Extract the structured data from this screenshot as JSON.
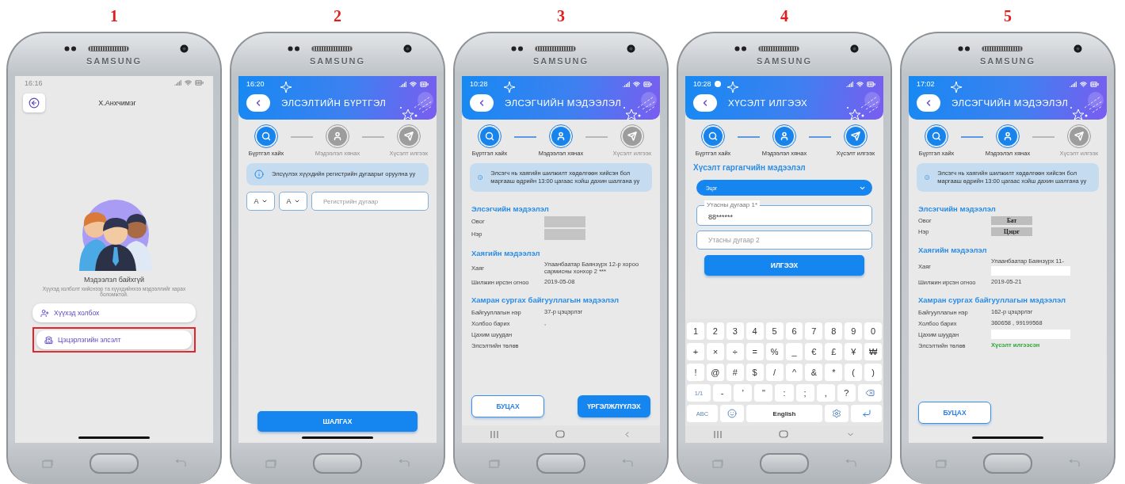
{
  "phones": [
    {
      "number": "1",
      "brand": "SAMSUNG",
      "screen": {
        "kind": "home",
        "time": "16:16",
        "user_name": "Х.Анхчимэг",
        "empty_title": "Мэдээлэл байхгүй",
        "empty_text": "Хүүхэд холболт хийснээр та хүүхдийнхээ мэдээллийг харах боломжтой.",
        "menu": [
          {
            "kind": "connect",
            "label": "Хүүхэд холбох",
            "highlighted": false
          },
          {
            "kind": "enroll",
            "label": "Цэцэрлэгийн элсэлт",
            "highlighted": true
          }
        ],
        "nav": {
          "kind": "gesture"
        }
      }
    },
    {
      "number": "2",
      "brand": "SAMSUNG",
      "screen": {
        "kind": "search",
        "time": "16:20",
        "title": "ЭЛСЭЛТИЙН БҮРТГЭЛ",
        "steps": [
          {
            "label": "Бүртгэл хайх",
            "active": true
          },
          {
            "label": "Мэдээлэл хянах",
            "active": false
          },
          {
            "label": "Хүсэлт илгээх",
            "active": false
          }
        ],
        "info": "Элсүүлэх хүүхдийн регистрийн дугаарыг оруулна уу",
        "selects": [
          "А",
          "А"
        ],
        "register_placeholder": "Регистрийн дугаар",
        "button": "ШАЛГАХ",
        "nav": {
          "kind": "gesture"
        }
      }
    },
    {
      "number": "3",
      "brand": "SAMSUNG",
      "screen": {
        "kind": "details",
        "time": "10:28",
        "title": "ЭЛСЭГЧИЙН МЭДЭЭЛЭЛ",
        "steps": [
          {
            "label": "Бүртгэл хайх",
            "active": true
          },
          {
            "label": "Мэдээлэл хянах",
            "active": true
          },
          {
            "label": "Хүсэлт илгээх",
            "active": false
          }
        ],
        "info": "Элсэгч нь хаягийн шилжилт хөдөлгөөн хийсэн бол маргааш өдрийн 13:00 цагаас хойш дахин шалгана уу",
        "sections": [
          {
            "heading": "Элсэгчийн мэдээлэл",
            "rows": [
              {
                "label": "Овог",
                "redacted": true
              },
              {
                "label": "Нэр",
                "redacted": true
              }
            ]
          },
          {
            "heading": "Хаягийн мэдээлэл",
            "rows": [
              {
                "label": "Хаяг",
                "value": "Улаанбаатар Баянзүрх 12-р хороо сармисны хонхор 2 ***"
              },
              {
                "label": "Шилжин ирсэн огноо",
                "value": "2019-05-08"
              }
            ]
          },
          {
            "heading": "Хамран сургах байгууллагын мэдээлэл",
            "rows": [
              {
                "label": "Байгууллагын нэр",
                "value": "37-р цэцэрлэг"
              },
              {
                "label": "Холбоо барих",
                "value": ","
              },
              {
                "label": "Цахим шуудан"
              },
              {
                "label": "Элсэлтийн төлөв"
              }
            ]
          }
        ],
        "buttons": [
          {
            "kind": "outline",
            "label": "БУЦАХ"
          },
          {
            "kind": "primary",
            "label": "ҮРГЭЛЖЛҮҮЛЭХ"
          }
        ],
        "nav": {
          "kind": "back"
        }
      }
    },
    {
      "number": "4",
      "brand": "SAMSUNG",
      "screen": {
        "kind": "request",
        "time": "10:28",
        "notification": true,
        "title": "ХҮСЭЛТ ИЛГЭЭХ",
        "steps": [
          {
            "label": "Бүртгэл хайх",
            "active": true
          },
          {
            "label": "Мэдээлэл хянах",
            "active": true
          },
          {
            "label": "Хүсэлт илгээх",
            "active": true
          }
        ],
        "heading": "Хүсэлт гаргагчийн мэдээлэл",
        "relation": "Эцэг",
        "phone_1": {
          "label": "Утасны дугаар 1*",
          "value": "88******"
        },
        "phone_2": {
          "placeholder": "Утасны дугаар 2"
        },
        "button": "ИЛГЭЭХ",
        "keyboard": [
          [
            {
              "kind": "char",
              "label": "1"
            },
            {
              "kind": "char",
              "label": "2"
            },
            {
              "kind": "char",
              "label": "3"
            },
            {
              "kind": "char",
              "label": "4"
            },
            {
              "kind": "char",
              "label": "5"
            },
            {
              "kind": "char",
              "label": "6"
            },
            {
              "kind": "char",
              "label": "7"
            },
            {
              "kind": "char",
              "label": "8"
            },
            {
              "kind": "char",
              "label": "9"
            },
            {
              "kind": "char",
              "label": "0"
            }
          ],
          [
            {
              "kind": "char",
              "label": "+"
            },
            {
              "kind": "char",
              "label": "×"
            },
            {
              "kind": "char",
              "label": "÷"
            },
            {
              "kind": "char",
              "label": "="
            },
            {
              "kind": "char",
              "label": "%"
            },
            {
              "kind": "char",
              "label": "_"
            },
            {
              "kind": "char",
              "label": "€"
            },
            {
              "kind": "char",
              "label": "£"
            },
            {
              "kind": "char",
              "label": "¥"
            },
            {
              "kind": "char",
              "label": "₩"
            }
          ],
          [
            {
              "kind": "char",
              "label": "!"
            },
            {
              "kind": "char",
              "label": "@"
            },
            {
              "kind": "char",
              "label": "#"
            },
            {
              "kind": "char",
              "label": "$"
            },
            {
              "kind": "char",
              "label": "/"
            },
            {
              "kind": "char",
              "label": "^"
            },
            {
              "kind": "char",
              "label": "&"
            },
            {
              "kind": "char",
              "label": "*"
            },
            {
              "kind": "char",
              "label": "("
            },
            {
              "kind": "char",
              "label": ")"
            }
          ],
          [
            {
              "kind": "mode",
              "label": "1/1"
            },
            {
              "kind": "char",
              "label": "-"
            },
            {
              "kind": "char",
              "label": "'"
            },
            {
              "kind": "char",
              "label": "\""
            },
            {
              "kind": "char",
              "label": ":"
            },
            {
              "kind": "char",
              "label": ";"
            },
            {
              "kind": "char",
              "label": ","
            },
            {
              "kind": "char",
              "label": "?"
            },
            {
              "kind": "backspace"
            }
          ],
          [
            {
              "kind": "mode",
              "label": "ABC"
            },
            {
              "kind": "emoji"
            },
            {
              "kind": "space",
              "label": "English"
            },
            {
              "kind": "settings"
            },
            {
              "kind": "enter"
            }
          ]
        ],
        "nav": {
          "kind": "collapse"
        }
      }
    },
    {
      "number": "5",
      "brand": "SAMSUNG",
      "screen": {
        "kind": "details",
        "time": "17:02",
        "title": "ЭЛСЭГЧИЙН МЭДЭЭЛЭЛ",
        "steps": [
          {
            "label": "Бүртгэл хайх",
            "active": true
          },
          {
            "label": "Мэдээлэл хянах",
            "active": true
          },
          {
            "label": "Хүсэлт илгээх",
            "active": false
          }
        ],
        "info": "Элсэгч нь хаягийн шилжилт хөдөлгөөн хийсэн бол маргааш өдрийн 13:00 цагаас хойш дахин шалгана уу",
        "sections": [
          {
            "heading": "Элсэгчийн мэдээлэл",
            "rows": [
              {
                "label": "Овог",
                "value": "Бат",
                "redacted": true
              },
              {
                "label": "Нэр",
                "value": "Цэцэг",
                "redacted": true
              }
            ]
          },
          {
            "heading": "Хаягийн мэдээлэл",
            "rows": [
              {
                "label": "Хаяг",
                "value": "Улаанбаатар Баянзүрх 11-",
                "blanked": true
              },
              {
                "label": "Шилжин ирсэн огноо",
                "value": "2019-05-21"
              }
            ]
          },
          {
            "heading": "Хамран сургах байгууллагын мэдээлэл",
            "rows": [
              {
                "label": "Байгууллагын нэр",
                "value": "162-р цэцэрлэг"
              },
              {
                "label": "Холбоо барих",
                "value": "360658 , 99199568"
              },
              {
                "label": "Цахим шуудан",
                "blanked": true
              },
              {
                "label": "Элсэлтийн төлөв",
                "value": "Хүсэлт илгээсэн",
                "kind": "status"
              }
            ]
          }
        ],
        "buttons": [
          {
            "kind": "outline",
            "label": "БУЦАХ"
          }
        ],
        "nav": {
          "kind": "gesture"
        }
      }
    }
  ]
}
